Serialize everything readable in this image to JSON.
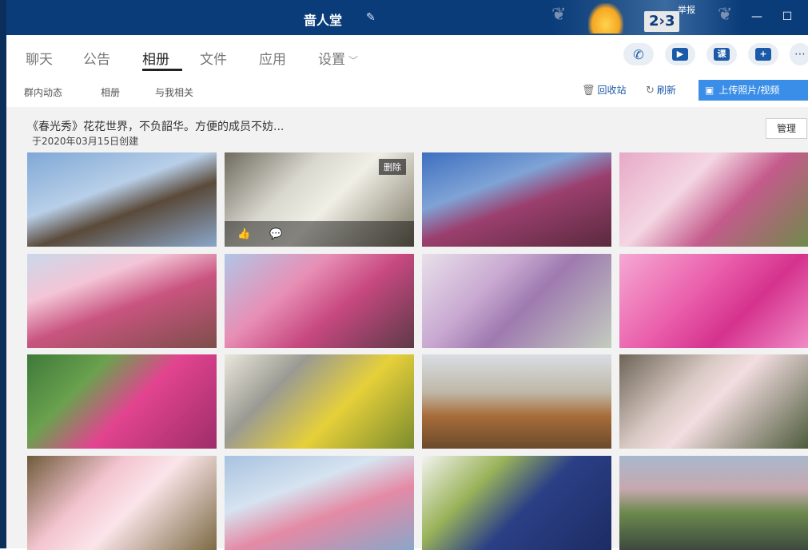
{
  "window": {
    "title": "啬人堂",
    "banner_score": "2›3",
    "banner_report": "举报",
    "minimize": "—",
    "maximize": "☐"
  },
  "tabs": [
    {
      "label": "聊天"
    },
    {
      "label": "公告"
    },
    {
      "label": "相册",
      "active": true
    },
    {
      "label": "文件"
    },
    {
      "label": "应用"
    },
    {
      "label": "设置"
    }
  ],
  "tab_actions": [
    {
      "name": "phone",
      "glyph": "✆"
    },
    {
      "name": "video",
      "glyph": "▶"
    },
    {
      "name": "lesson",
      "glyph": "课"
    },
    {
      "name": "add",
      "glyph": "+"
    }
  ],
  "subtabs": [
    {
      "label": "群内动态"
    },
    {
      "label": "相册"
    },
    {
      "label": "与我相关"
    }
  ],
  "actions": {
    "recycle": "回收站",
    "refresh": "刷新",
    "upload": "上传照片/视频"
  },
  "album": {
    "title": "《春光秀》花花世界，不负韶华。方便的成员不妨...",
    "created": "于2020年03月15日创建",
    "manage": "管理",
    "delete_label": "删除"
  },
  "photos": [
    {
      "alt": "magnolia-branches-sky",
      "bg": "linear-gradient(160deg,#7fa8d6 0%,#b8cfe8 40%,#5a4a3a 60%,#8aa6c9 100%)"
    },
    {
      "alt": "white-magnolia-close",
      "bg": "linear-gradient(135deg,#6e6a5e 0%,#d9d8cf 35%,#f0efe6 55%,#7a7563 100%)",
      "hovered": true
    },
    {
      "alt": "pink-buds-blue-sky",
      "bg": "linear-gradient(160deg,#3d6fc0 0%,#7fa3d6 35%,#9b3f6e 55%,#5a2a3e 100%)"
    },
    {
      "alt": "pink-magnolia-blooms",
      "bg": "linear-gradient(135deg,#e7a9c8 0%,#f4d6e2 35%,#c45b8c 60%,#6f8a4a 100%)"
    },
    {
      "alt": "pink-magnolia-building",
      "bg": "linear-gradient(160deg,#c9d8ea 0%,#f3c5d6 30%,#c9547f 55%,#7d4e4a 100%)"
    },
    {
      "alt": "pink-magnolia-cluster",
      "bg": "linear-gradient(140deg,#b0c6e6 0%,#e88fb5 35%,#c74880 60%,#5d3a48 100%)"
    },
    {
      "alt": "lilac-close-up",
      "bg": "linear-gradient(135deg,#e8e0ea 0%,#c8a8d1 35%,#9e7ab0 55%,#c4ccbf 100%)"
    },
    {
      "alt": "pink-peony",
      "bg": "linear-gradient(135deg,#f5a9d4 0%,#ea5fab 40%,#d5328e 65%,#f08cc6 100%)"
    },
    {
      "alt": "pink-fruit-leaf-drop",
      "bg": "linear-gradient(135deg,#3d7a3a 0%,#6ba14e 30%,#e2448f 55%,#9e2d6a 100%)"
    },
    {
      "alt": "forsythia-roof-tiles",
      "bg": "linear-gradient(135deg,#eae7dc 0%,#9a9a92 30%,#e6d03a 60%,#7b8c2e 100%)"
    },
    {
      "alt": "people-on-bridge",
      "bg": "linear-gradient(180deg,#d9dde3 0%,#bfb8a8 40%,#a86d3a 65%,#6b4a2c 100%)"
    },
    {
      "alt": "blossom-by-water",
      "bg": "linear-gradient(135deg,#6c6455 0%,#d9c9c4 35%,#f2dde0 50%,#4d5a3a 100%)"
    },
    {
      "alt": "peach-blossom-branch",
      "bg": "linear-gradient(135deg,#6f5a3a 0%,#f3c4cf 35%,#fbe5ea 55%,#7c6a43 100%)"
    },
    {
      "alt": "peach-blossom-sky",
      "bg": "linear-gradient(160deg,#a8c2e0 0%,#d6e3f0 35%,#e48aa5 60%,#8aa6c9 100%)"
    },
    {
      "alt": "blue-roof-tiles-blossom",
      "bg": "linear-gradient(135deg,#f3f3ef 0%,#9ab35a 30%,#2b3f86 55%,#1c2c63 100%)"
    },
    {
      "alt": "park-pond-swans",
      "bg": "linear-gradient(180deg,#a8b8cc 0%,#c7a8b0 35%,#6d8a4e 60%,#3c4a3e 100%)"
    }
  ]
}
